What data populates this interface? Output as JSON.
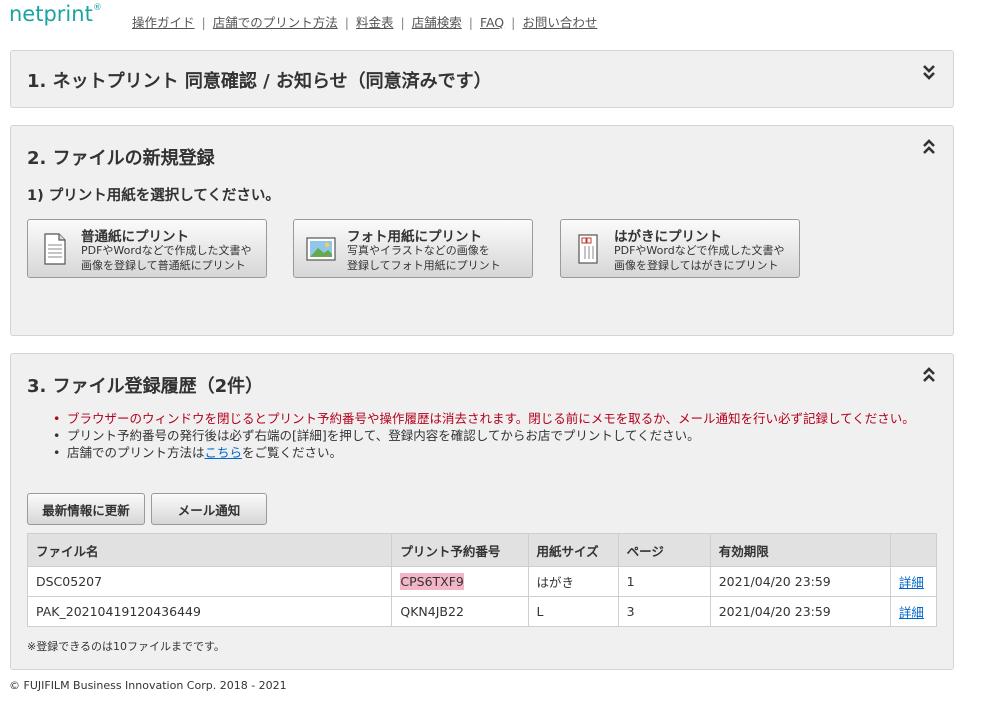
{
  "header": {
    "logo": "netprint",
    "logo_mark": "®",
    "nav": [
      "操作ガイド",
      "店舗でのプリント方法",
      "料金表",
      "店舗検索",
      "FAQ",
      "お問い合わせ"
    ]
  },
  "section1": {
    "title": "1. ネットプリント 同意確認 / お知らせ（同意済みです）"
  },
  "section2": {
    "title": "2. ファイルの新規登録",
    "subtitle": "1) プリント用紙を選択してください。",
    "buttons": [
      {
        "label": "普通紙にプリント",
        "desc1": "PDFやWordなどで作成した文書や",
        "desc2": "画像を登録して普通紙にプリント"
      },
      {
        "label": "フォト用紙にプリント",
        "desc1": "写真やイラストなどの画像を",
        "desc2": "登録してフォト用紙にプリント"
      },
      {
        "label": "はがきにプリント",
        "desc1": "PDFやWordなどで作成した文書や",
        "desc2": "画像を登録してはがきにプリント"
      }
    ]
  },
  "section3": {
    "title": "3. ファイル登録履歴（2件）",
    "notes": {
      "warning": "ブラウザーのウィンドウを閉じるとプリント予約番号や操作履歴は消去されます。閉じる前にメモを取るか、メール通知を行い必ず記録してください。",
      "note2": "プリント予約番号の発行後は必ず右端の[詳細]を押して、登録内容を確認してからお店でプリントしてください。",
      "note3_pre": "店舗でのプリント方法は",
      "note3_link": "こちら",
      "note3_post": "をご覧ください。"
    },
    "refresh_label": "最新情報に更新",
    "mail_label": "メール通知",
    "columns": [
      "ファイル名",
      "プリント予約番号",
      "用紙サイズ",
      "ページ",
      "有効期限",
      ""
    ],
    "rows": [
      {
        "file": "DSC05207",
        "code": "CPS6TXF9",
        "size": "はがき",
        "pages": "1",
        "expires": "2021/04/20 23:59",
        "detail": "詳細"
      },
      {
        "file": "PAK_20210419120436449",
        "code": "QKN4JB22",
        "size": "L",
        "pages": "3",
        "expires": "2021/04/20 23:59",
        "detail": "詳細"
      }
    ],
    "footnote": "※登録できるのは10ファイルまでです。"
  },
  "footer": {
    "copyright": "© FUJIFILM Business Innovation Corp. 2018 - 2021"
  },
  "colors": {
    "logo": "#1aa3a3",
    "warning": "#b3001b",
    "link": "#0066cc",
    "highlight": "#f3b6c9",
    "panel": "#f0f0f0"
  }
}
